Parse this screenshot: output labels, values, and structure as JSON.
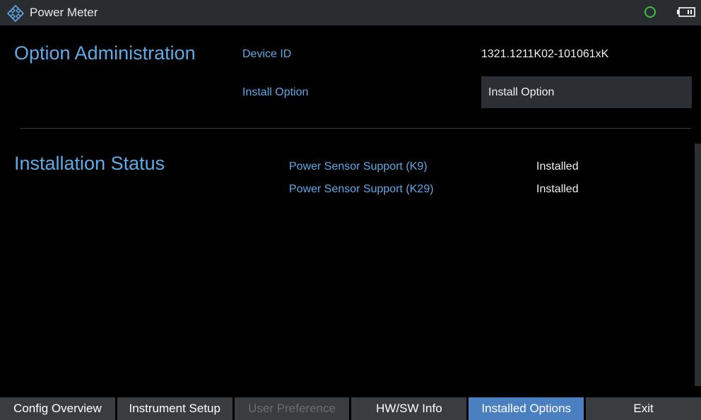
{
  "titlebar": {
    "title": "Power Meter",
    "logo_icon": "rohde-schwarz-diamond-logo-icon",
    "status_icon": "status-circle-icon",
    "status_color": "#3fbf3f",
    "battery_icon": "battery-icon"
  },
  "option_admin": {
    "heading": "Option Administration",
    "device_id_label": "Device ID",
    "device_id_value": "1321.1211K02-101061xK",
    "install_option_label": "Install Option",
    "install_option_button": "Install Option"
  },
  "installation_status": {
    "heading": "Installation Status",
    "options": [
      {
        "name": "Power Sensor Support (K9)",
        "status": "Installed"
      },
      {
        "name": "Power Sensor Support (K29)",
        "status": "Installed"
      }
    ]
  },
  "softkeys": [
    {
      "label": "Config Overview",
      "state": "normal"
    },
    {
      "label": "Instrument Setup",
      "state": "normal"
    },
    {
      "label": "User Preference",
      "state": "disabled"
    },
    {
      "label": "HW/SW Info",
      "state": "normal"
    },
    {
      "label": "Installed Options",
      "state": "active"
    },
    {
      "label": "Exit",
      "state": "normal"
    }
  ],
  "colors": {
    "accent_blue": "#5ea9e6",
    "active_softkey": "#4a7fc0",
    "softkey_bg": "#3a3d40",
    "titlebar_bg": "#2a2d30"
  }
}
